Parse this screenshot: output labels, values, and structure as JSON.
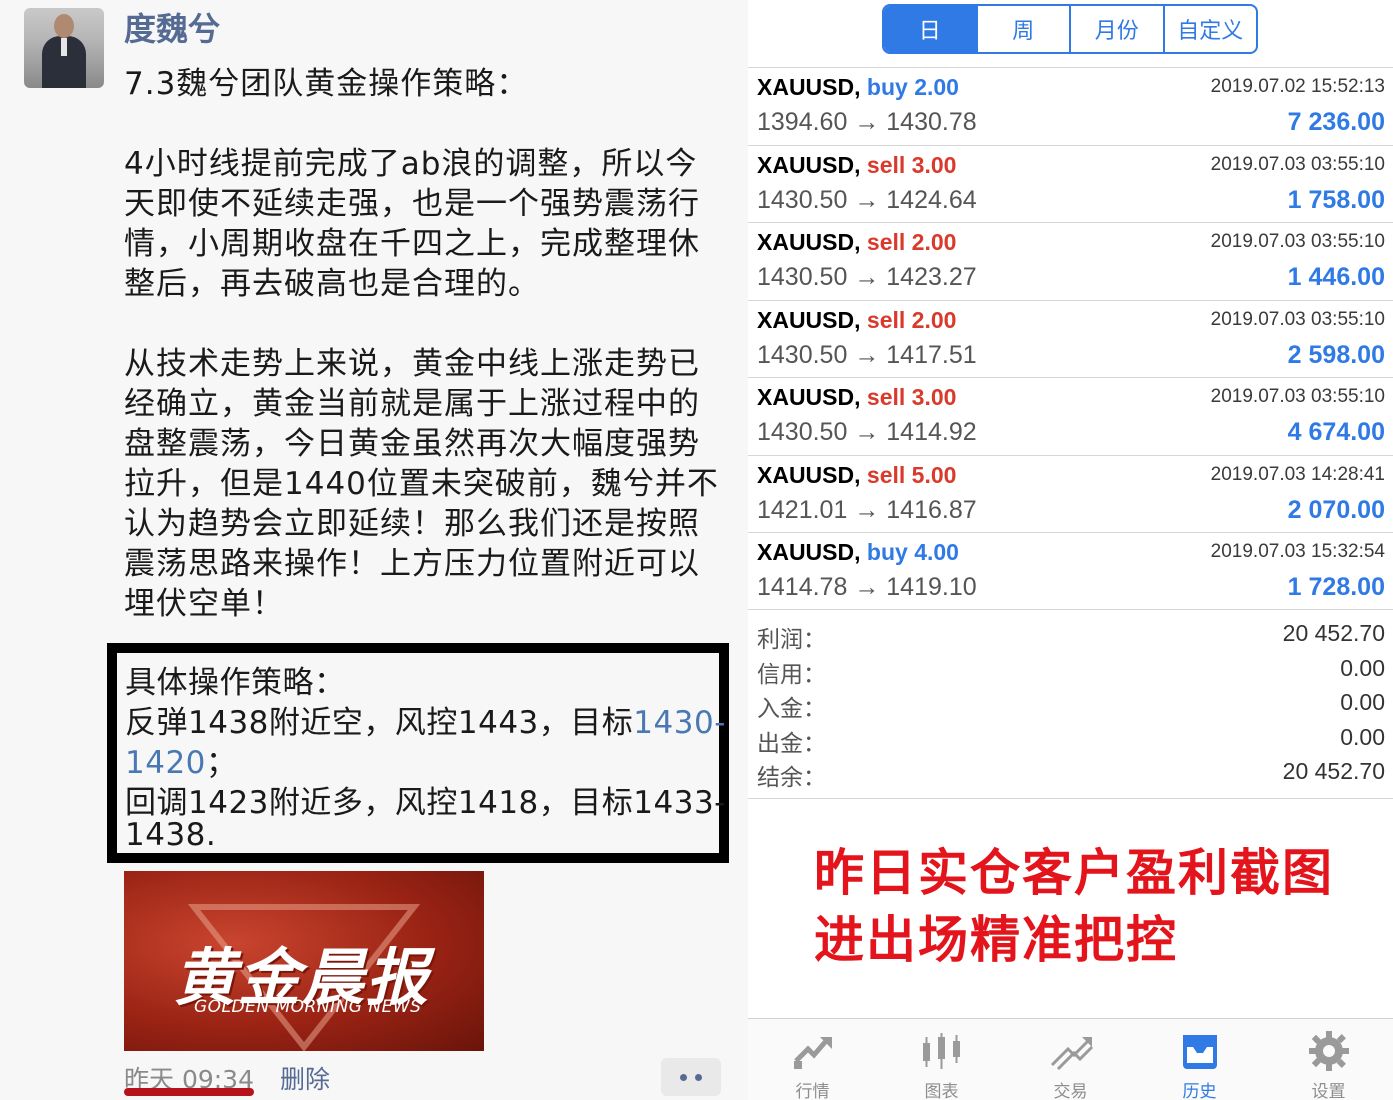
{
  "post": {
    "username": "度魏兮",
    "title": "7.3魏兮团队黄金操作策略：",
    "paragraph1": [
      "4小时线提前完成了ab浪的调整，所以今",
      "天即使不延续走强，也是一个强势震荡行",
      "情，小周期收盘在千四之上，完成整理休",
      "整后，再去破高也是合理的。"
    ],
    "paragraph2": [
      "从技术走势上来说，黄金中线上涨走势已",
      "经确立，黄金当前就是属于上涨过程中的",
      "盘整震荡，今日黄金虽然再次大幅度强势",
      "拉升，但是1440位置未突破前，魏兮并不",
      "认为趋势会立即延续！那么我们还是按照",
      "震荡思路来操作！上方压力位置附近可以",
      "埋伏空单！"
    ],
    "strategy": {
      "heading": "具体操作策略：",
      "line1_prefix": "反弹1438附近空，风控1443，目标",
      "line1_link": "1430-",
      "line2_link": "1420",
      "line2_suffix": "；",
      "line3": "回调1423附近多，风控1418，目标1433-",
      "line4": "1438."
    },
    "banner": {
      "title": "黄金晨报",
      "subtitle": "GOLDEN MORNING NEWS"
    },
    "time": "昨天 09:34",
    "delete_label": "删除"
  },
  "history": {
    "period_tabs": [
      {
        "label": "日",
        "active": true
      },
      {
        "label": "周",
        "active": false
      },
      {
        "label": "月份",
        "active": false
      },
      {
        "label": "自定义",
        "active": false
      }
    ],
    "trades": [
      {
        "symbol": "XAUUSD,",
        "side": "buy",
        "lots": "2.00",
        "date": "2019.07.02 15:52:13",
        "open": "1394.60",
        "close": "1430.78",
        "profit": "7 236.00"
      },
      {
        "symbol": "XAUUSD,",
        "side": "sell",
        "lots": "3.00",
        "date": "2019.07.03 03:55:10",
        "open": "1430.50",
        "close": "1424.64",
        "profit": "1 758.00"
      },
      {
        "symbol": "XAUUSD,",
        "side": "sell",
        "lots": "2.00",
        "date": "2019.07.03 03:55:10",
        "open": "1430.50",
        "close": "1423.27",
        "profit": "1 446.00"
      },
      {
        "symbol": "XAUUSD,",
        "side": "sell",
        "lots": "2.00",
        "date": "2019.07.03 03:55:10",
        "open": "1430.50",
        "close": "1417.51",
        "profit": "2 598.00"
      },
      {
        "symbol": "XAUUSD,",
        "side": "sell",
        "lots": "3.00",
        "date": "2019.07.03 03:55:10",
        "open": "1430.50",
        "close": "1414.92",
        "profit": "4 674.00"
      },
      {
        "symbol": "XAUUSD,",
        "side": "sell",
        "lots": "5.00",
        "date": "2019.07.03 14:28:41",
        "open": "1421.01",
        "close": "1416.87",
        "profit": "2 070.00"
      },
      {
        "symbol": "XAUUSD,",
        "side": "buy",
        "lots": "4.00",
        "date": "2019.07.03 15:32:54",
        "open": "1414.78",
        "close": "1419.10",
        "profit": "1 728.00"
      }
    ],
    "arrow": "→",
    "summary": [
      {
        "label": "利润：",
        "value": "20 452.70"
      },
      {
        "label": "信用：",
        "value": "0.00"
      },
      {
        "label": "入金：",
        "value": "0.00"
      },
      {
        "label": "出金：",
        "value": "0.00"
      },
      {
        "label": "结余：",
        "value": "20 452.70"
      }
    ],
    "promo_lines": [
      "昨日实仓客户盈利截图",
      "进出场精准把控"
    ],
    "tabbar": [
      {
        "label": "行情",
        "icon": "quotes-icon",
        "active": false
      },
      {
        "label": "图表",
        "icon": "chart-icon",
        "active": false
      },
      {
        "label": "交易",
        "icon": "trade-icon",
        "active": false
      },
      {
        "label": "历史",
        "icon": "history-icon",
        "active": true
      },
      {
        "label": "设置",
        "icon": "settings-icon",
        "active": false
      }
    ]
  },
  "colors": {
    "accent": "#2f7ae5",
    "sell": "#d93a2b",
    "promo": "#e3141b",
    "username": "#566b94",
    "link": "#4a78b3"
  }
}
